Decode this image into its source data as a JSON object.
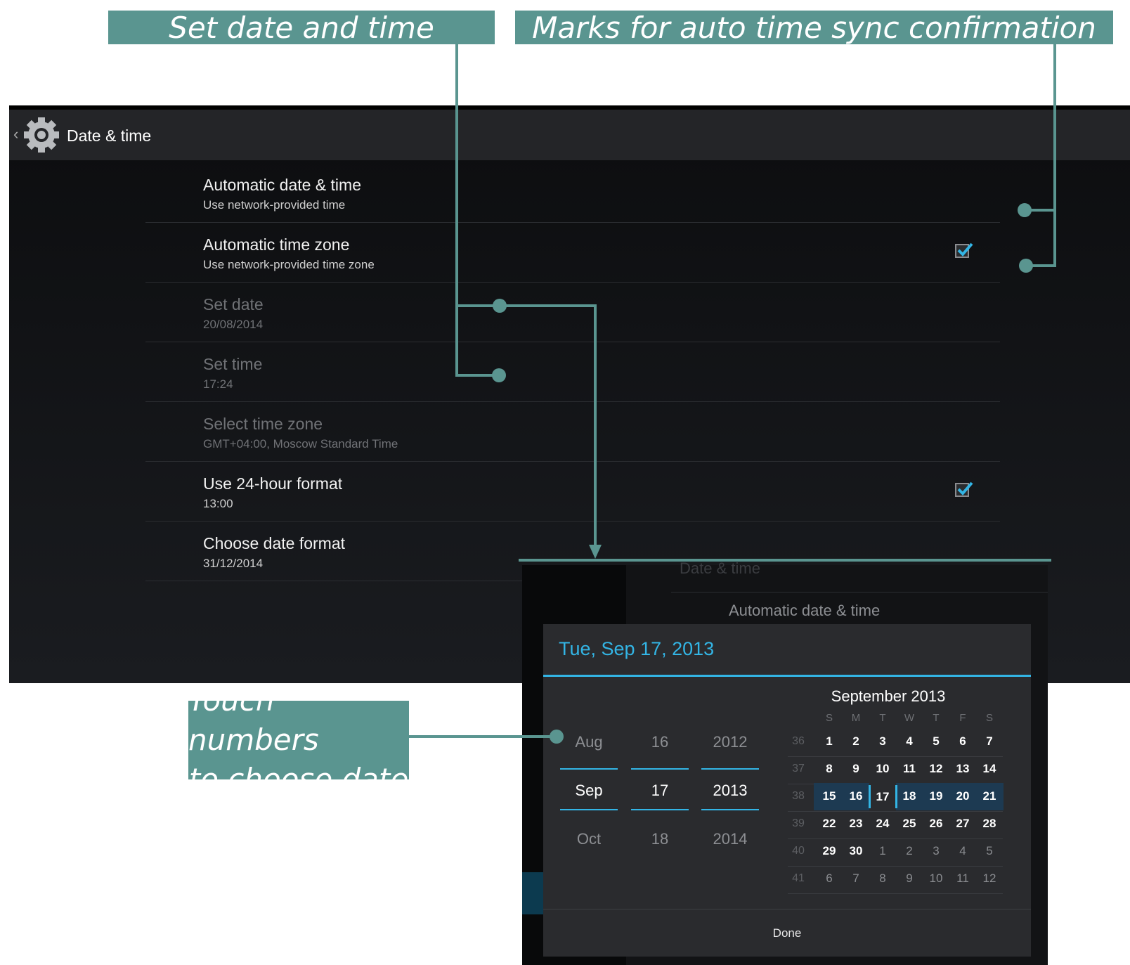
{
  "callouts": {
    "set_date_time": "Set date and time",
    "marks": "Marks for auto time sync confirmation",
    "touch_line1": "Touch numbers",
    "touch_line2": "to choose date"
  },
  "settings": {
    "title": "Date & time",
    "rows": [
      {
        "title": "Automatic date & time",
        "summary": "Use network-provided time",
        "checked": false,
        "disabled": false
      },
      {
        "title": "Automatic time zone",
        "summary": "Use network-provided time zone",
        "checked": true,
        "disabled": false
      },
      {
        "title": "Set date",
        "summary": "20/08/2014",
        "disabled": true
      },
      {
        "title": "Set time",
        "summary": "17:24",
        "disabled": true
      },
      {
        "title": "Select time zone",
        "summary": "GMT+04:00, Moscow Standard Time",
        "disabled": true
      },
      {
        "title": "Use 24-hour format",
        "summary": "13:00",
        "checked": true,
        "disabled": false
      },
      {
        "title": "Choose date format",
        "summary": "31/12/2014",
        "disabled": false
      }
    ]
  },
  "background_screen": {
    "label": "Automatic date & time",
    "ghost": "Date & time"
  },
  "date_picker": {
    "title": "Tue, Sep 17, 2013",
    "month_spinner": {
      "prev": "Aug",
      "current": "Sep",
      "next": "Oct"
    },
    "day_spinner": {
      "prev": "16",
      "current": "17",
      "next": "18"
    },
    "year_spinner": {
      "prev": "2012",
      "current": "2013",
      "next": "2014"
    },
    "calendar_title": "September 2013",
    "weekdays": [
      "S",
      "M",
      "T",
      "W",
      "T",
      "F",
      "S"
    ],
    "weeks": [
      {
        "week": "36",
        "days": [
          "1",
          "2",
          "3",
          "4",
          "5",
          "6",
          "7"
        ]
      },
      {
        "week": "37",
        "days": [
          "8",
          "9",
          "10",
          "11",
          "12",
          "13",
          "14"
        ]
      },
      {
        "week": "38",
        "days": [
          "15",
          "16",
          "17",
          "18",
          "19",
          "20",
          "21"
        ]
      },
      {
        "week": "39",
        "days": [
          "22",
          "23",
          "24",
          "25",
          "26",
          "27",
          "28"
        ]
      },
      {
        "week": "40",
        "days": [
          "29",
          "30",
          "1",
          "2",
          "3",
          "4",
          "5"
        ]
      },
      {
        "week": "41",
        "days": [
          "6",
          "7",
          "8",
          "9",
          "10",
          "11",
          "12"
        ]
      }
    ],
    "selected_day": "17",
    "done_label": "Done"
  },
  "colors": {
    "callout": "#5a9590",
    "accent": "#33b5e5"
  },
  "icons": {
    "back": "chevron-left-icon",
    "settings": "gear-icon",
    "checkbox": "check-icon"
  }
}
